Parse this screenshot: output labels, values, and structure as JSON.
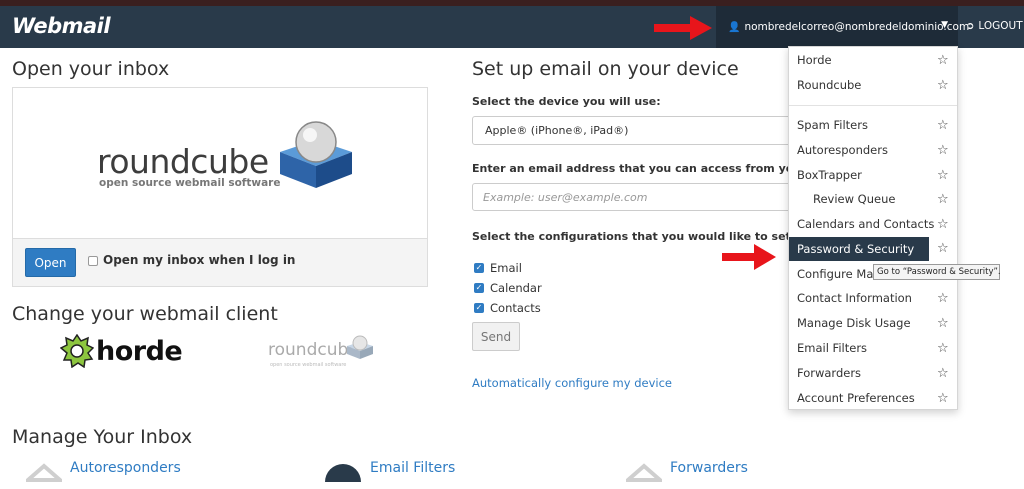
{
  "header": {
    "brand": "Webmail",
    "user_email": "nombredelcorreo@nombredeldominio.com",
    "logout_label": "LOGOUT"
  },
  "left": {
    "open_title": "Open your inbox",
    "rc_word": "roundcube",
    "rc_tagline": "open source webmail software",
    "open_button": "Open",
    "open_checkbox_label": "Open my inbox when I log in",
    "change_title": "Change your webmail client",
    "horde_word": "horde",
    "rc_small_word": "roundcube",
    "rc_small_tag": "open source webmail software",
    "manage_title": "Manage Your Inbox",
    "manage_items": [
      "Autoresponders",
      "Email Filters",
      "Forwarders"
    ]
  },
  "setup": {
    "title": "Set up email on your device",
    "device_label": "Select the device you will use:",
    "device_value": "Apple® (iPhone®, iPad®)",
    "email_label": "Enter an email address that you can access from your de",
    "email_placeholder": "Example: user@example.com",
    "config_label": "Select the configurations that you would like to set up:",
    "configs": [
      "Email",
      "Calendar",
      "Contacts"
    ],
    "send_button": "Send",
    "auto_link": "Automatically configure my device"
  },
  "dropdown": {
    "clients": [
      "Horde",
      "Roundcube"
    ],
    "items": [
      "Spam Filters",
      "Autoresponders",
      "BoxTrapper",
      "Review Queue",
      "Calendars and Contacts",
      "Password & Security",
      "Configure Mail",
      "Contact Information",
      "Manage Disk Usage",
      "Email Filters",
      "Forwarders",
      "Account Preferences"
    ],
    "tooltip": "Go to “Password & Security”."
  },
  "colors": {
    "navbar": "#293a4a",
    "accent": "#2f7cc3",
    "arrow": "#e8151b"
  },
  "icons": {
    "user": "user-icon",
    "logout": "logout-icon",
    "star": "star-icon",
    "caret": "caret-down-icon"
  }
}
